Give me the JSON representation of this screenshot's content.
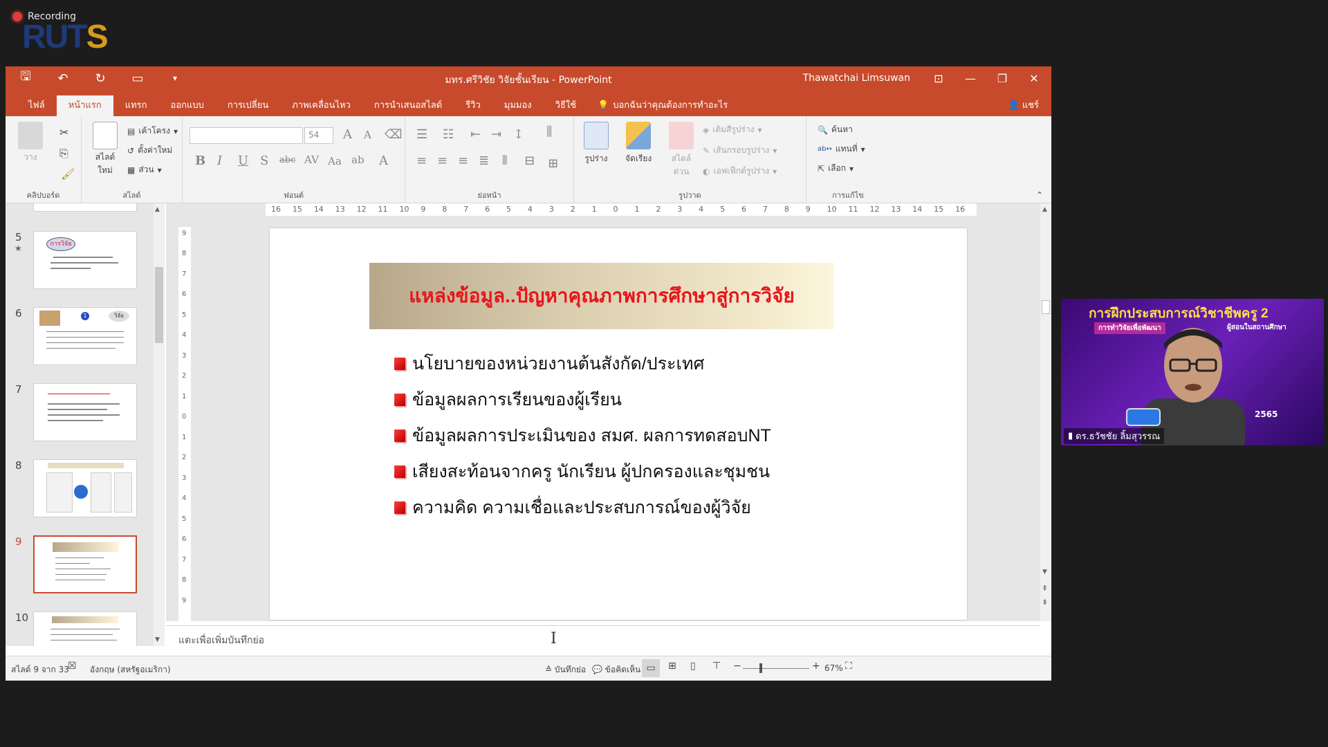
{
  "overlay": {
    "recording_label": "Recording",
    "logo_part1": "RUT",
    "logo_part2": "S"
  },
  "window": {
    "doc_title": "มทร.ศรีวิชัย วิจัยชั้นเรียน  -  PowerPoint",
    "user": "Thawatchai Limsuwan"
  },
  "tabs": [
    "ไฟล์",
    "หน้าแรก",
    "แทรก",
    "ออกแบบ",
    "การเปลี่ยน",
    "ภาพเคลื่อนไหว",
    "การนำเสนอสไลด์",
    "รีวิว",
    "มุมมอง",
    "วิธีใช้"
  ],
  "tell_me": "บอกฉันว่าคุณต้องการทำอะไร",
  "share": "แชร์",
  "ribbon": {
    "clipboard": {
      "label": "คลิปบอร์ด",
      "paste": "วาง"
    },
    "slides": {
      "label": "สไลด์",
      "new_slide": "สไลด์ ใหม่",
      "layout": "เค้าโครง",
      "reset": "ตั้งค่าใหม่",
      "section": "ส่วน"
    },
    "font": {
      "label": "ฟอนต์",
      "font_size": "54"
    },
    "paragraph": {
      "label": "ย่อหน้า"
    },
    "drawing": {
      "label": "รูปวาด",
      "shapes": "รูปร่าง",
      "arrange": "จัดเรียง",
      "quick_styles": "สไตล์ ด่วน",
      "shape_fill": "เติมสีรูปร่าง",
      "shape_outline": "เส้นกรอบรูปร่าง",
      "shape_effects": "เอฟเฟ็กต์รูปร่าง"
    },
    "editing": {
      "label": "การแก้ไข",
      "find": "ค้นหา",
      "replace": "แทนที่",
      "select": "เลือก"
    }
  },
  "thumbnails": [
    {
      "num": "5",
      "star": "★"
    },
    {
      "num": "6"
    },
    {
      "num": "7"
    },
    {
      "num": "8"
    },
    {
      "num": "9",
      "active": true
    },
    {
      "num": "10"
    }
  ],
  "thumb_texts": {
    "t5_label": "การวิจัย",
    "t6_label": "วิจัย",
    "t6_num": "1"
  },
  "ruler": {
    "h_ticks": [
      "16",
      "15",
      "14",
      "13",
      "12",
      "11",
      "10",
      "9",
      "8",
      "7",
      "6",
      "5",
      "4",
      "3",
      "2",
      "1",
      "0",
      "1",
      "2",
      "3",
      "4",
      "5",
      "6",
      "7",
      "8",
      "9",
      "10",
      "11",
      "12",
      "13",
      "14",
      "15",
      "16"
    ],
    "v_ticks": [
      "9",
      "8",
      "7",
      "6",
      "5",
      "4",
      "3",
      "2",
      "1",
      "0",
      "1",
      "2",
      "3",
      "4",
      "5",
      "6",
      "7",
      "8",
      "9"
    ]
  },
  "slide": {
    "title": "แหล่งข้อมูล..ปัญหาคุณภาพการศึกษาสู่การวิจัย",
    "bullets": [
      "นโยบายของหน่วยงานต้นสังกัด/ประเทศ",
      "ข้อมูลผลการเรียนของผู้เรียน",
      "ข้อมูลผลการประเมินของ สมศ. ผลการทดสอบNT",
      "เสียงสะท้อนจากครู นักเรียน ผู้ปกครองและชุมชน",
      "ความคิด ความเชื่อและประสบการณ์ของผู้วิจัย"
    ]
  },
  "notes": {
    "placeholder": "แตะเพื่อเพิ่มบันทึกย่อ"
  },
  "status": {
    "slide_pos": "สไลด์ 9 จาก 33",
    "language": "อังกฤษ (สหรัฐอเมริกา)",
    "notes_btn": "บันทึกย่อ",
    "comments_btn": "ข้อคิดเห็น",
    "zoom": "67%"
  },
  "webcam": {
    "title": "การฝึกประสบการณ์วิชาชีพครู 2",
    "sub_left": "การทำวิจัยเพื่อพัฒนา",
    "sub_right": "ผู้สอนในสถานศึกษา",
    "name": "ดร.ธวัชชัย ลิ้มสุวรรณ",
    "year": "2565"
  },
  "colors": {
    "accent": "#c64a2b",
    "title_red": "#e8141b"
  }
}
